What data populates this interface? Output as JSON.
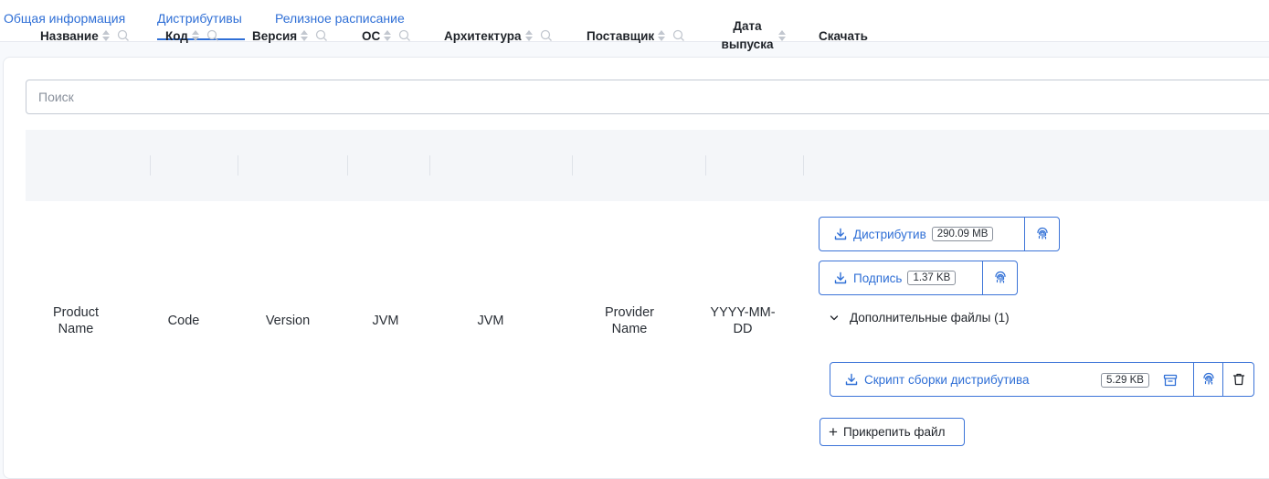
{
  "tabs": [
    {
      "label": "Общая информация",
      "active": false
    },
    {
      "label": "Дистрибутивы",
      "active": true
    },
    {
      "label": "Релизное расписание",
      "active": false
    }
  ],
  "search": {
    "placeholder": "Поиск",
    "value": ""
  },
  "table": {
    "columns": [
      "Название",
      "Код",
      "Версия",
      "ОС",
      "Архитектура",
      "Поставщик",
      "Дата выпуска",
      "Скачать"
    ],
    "row": {
      "name": "Product Name",
      "code": "Code",
      "version": "Version",
      "os": "JVM",
      "arch": "JVM",
      "vendor": "Provider Name",
      "date": "YYYY-MM-DD"
    }
  },
  "downloads": {
    "distribution": {
      "label": "Дистрибутив",
      "size": "290.09 MB"
    },
    "signature": {
      "label": "Подпись",
      "size": "1.37 KB"
    },
    "extra_files_label": "Дополнительные файлы (1)",
    "extra_file": {
      "label": "Скрипт сборки дистрибутива",
      "size": "5.29 KB"
    },
    "attach_label": "Прикрепить файл"
  },
  "colors": {
    "accent": "#2f6fd6",
    "header_bg": "#f4f6f9",
    "border": "#c4cad4"
  },
  "icons": [
    "download-icon",
    "fingerprint-icon",
    "archive-icon",
    "trash-icon",
    "chevron-down-icon",
    "plus-icon",
    "search-icon",
    "sort-icon"
  ]
}
